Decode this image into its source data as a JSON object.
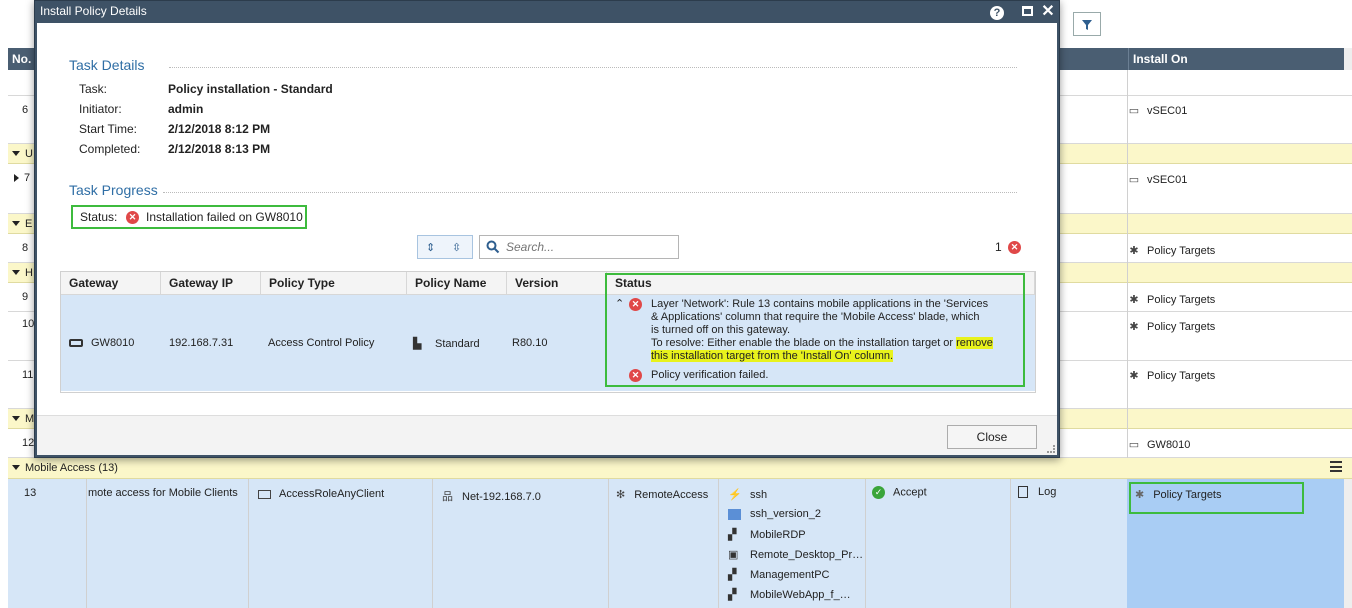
{
  "dialog": {
    "title": "Install Policy Details",
    "help_icon": "help-icon",
    "task_details_title": "Task Details",
    "task_label": "Task:",
    "task_value": "Policy installation - Standard",
    "initiator_label": "Initiator:",
    "initiator_value": "admin",
    "start_label": "Start Time:",
    "start_value": "2/12/2018 8:12 PM",
    "completed_label": "Completed:",
    "completed_value": "2/12/2018 8:13 PM",
    "task_progress_title": "Task Progress",
    "status_label": "Status:",
    "status_value": "Installation failed on GW8010",
    "search_placeholder": "Search...",
    "error_count": "1",
    "columns": [
      "Gateway",
      "Gateway IP",
      "Policy Type",
      "Policy Name",
      "Version",
      "Status"
    ],
    "row": {
      "gateway": "GW8010",
      "ip": "192.168.7.31",
      "policy_type": "Access Control Policy",
      "policy_name": "Standard",
      "version": "R80.10",
      "status_line1": "Layer 'Network': Rule 13 contains mobile applications in the 'Services",
      "status_line2": "& Applications' column that require the 'Mobile Access' blade, which",
      "status_line3": "is turned off on this gateway.",
      "status_line4a": "To resolve: Either enable the blade on the installation target or ",
      "status_line4b": "remove",
      "status_line5": "this installation target from the 'Install On' column.",
      "status_line6": "Policy verification failed."
    },
    "close_label": "Close"
  },
  "grid": {
    "no_header": "No.",
    "install_on_header": "Install On",
    "sections": [
      {
        "label": "U"
      },
      {
        "label": "E"
      },
      {
        "label": "H"
      },
      {
        "label": "M"
      },
      {
        "label": "Mobile Access (13)"
      }
    ],
    "rows": [
      {
        "no": "6",
        "install_on": "vSEC01"
      },
      {
        "no": "7",
        "install_on": "vSEC01"
      },
      {
        "no": "8",
        "install_on": "Policy Targets"
      },
      {
        "no": "9",
        "install_on": "Policy Targets"
      },
      {
        "no": "10",
        "install_on": "Policy Targets"
      },
      {
        "no": "11",
        "install_on": "Policy Targets"
      },
      {
        "no": "12",
        "install_on": "GW8010"
      }
    ],
    "rule13": {
      "no": "13",
      "name": "mote access for Mobile Clients",
      "source": "AccessRoleAnyClient",
      "destination": "Net-192.168.7.0",
      "vpn": "RemoteAccess",
      "services": [
        "ssh",
        "ssh_version_2",
        "MobileRDP",
        "Remote_Desktop_Pr…",
        "ManagementPC",
        "MobileWebApp_f_…"
      ],
      "action": "Accept",
      "track": "Log",
      "install_on": "Policy Targets"
    }
  }
}
